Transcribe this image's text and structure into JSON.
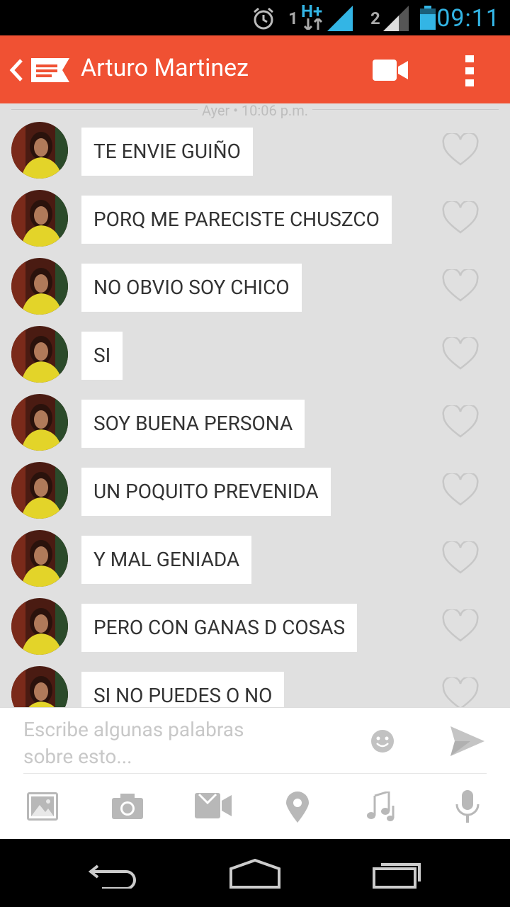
{
  "status_bar": {
    "time": "09:11",
    "sim1": "1",
    "sim2": "2",
    "network": "H+"
  },
  "header": {
    "title": "Arturo Martinez"
  },
  "conversation": {
    "date_label": "Ayer • 10:06 p.m.",
    "messages": [
      {
        "text": "TE ENVIE GUIÑO"
      },
      {
        "text": "PORQ ME PARECISTE CHUSZCO"
      },
      {
        "text": "NO OBVIO SOY CHICO"
      },
      {
        "text": "SI"
      },
      {
        "text": "SOY BUENA PERSONA"
      },
      {
        "text": "UN POQUITO PREVENIDA"
      },
      {
        "text": "Y MAL GENIADA"
      },
      {
        "text": "PERO CON GANAS D COSAS"
      },
      {
        "text": "SI NO PUEDES O NO"
      }
    ]
  },
  "composer": {
    "placeholder_line1": "Escribe algunas palabras",
    "placeholder_line2": "sobre esto..."
  },
  "colors": {
    "accent": "#f05133",
    "chat_bg": "#e0e0e0",
    "status_blue": "#33b5e5"
  },
  "icons": [
    "back-icon",
    "message-icon",
    "video-call-icon",
    "overflow-menu-icon",
    "heart-icon",
    "emoji-icon",
    "send-icon",
    "gallery-icon",
    "camera-icon",
    "video-icon",
    "location-icon",
    "music-icon",
    "microphone-icon",
    "nav-back-icon",
    "nav-home-icon",
    "nav-recents-icon"
  ]
}
